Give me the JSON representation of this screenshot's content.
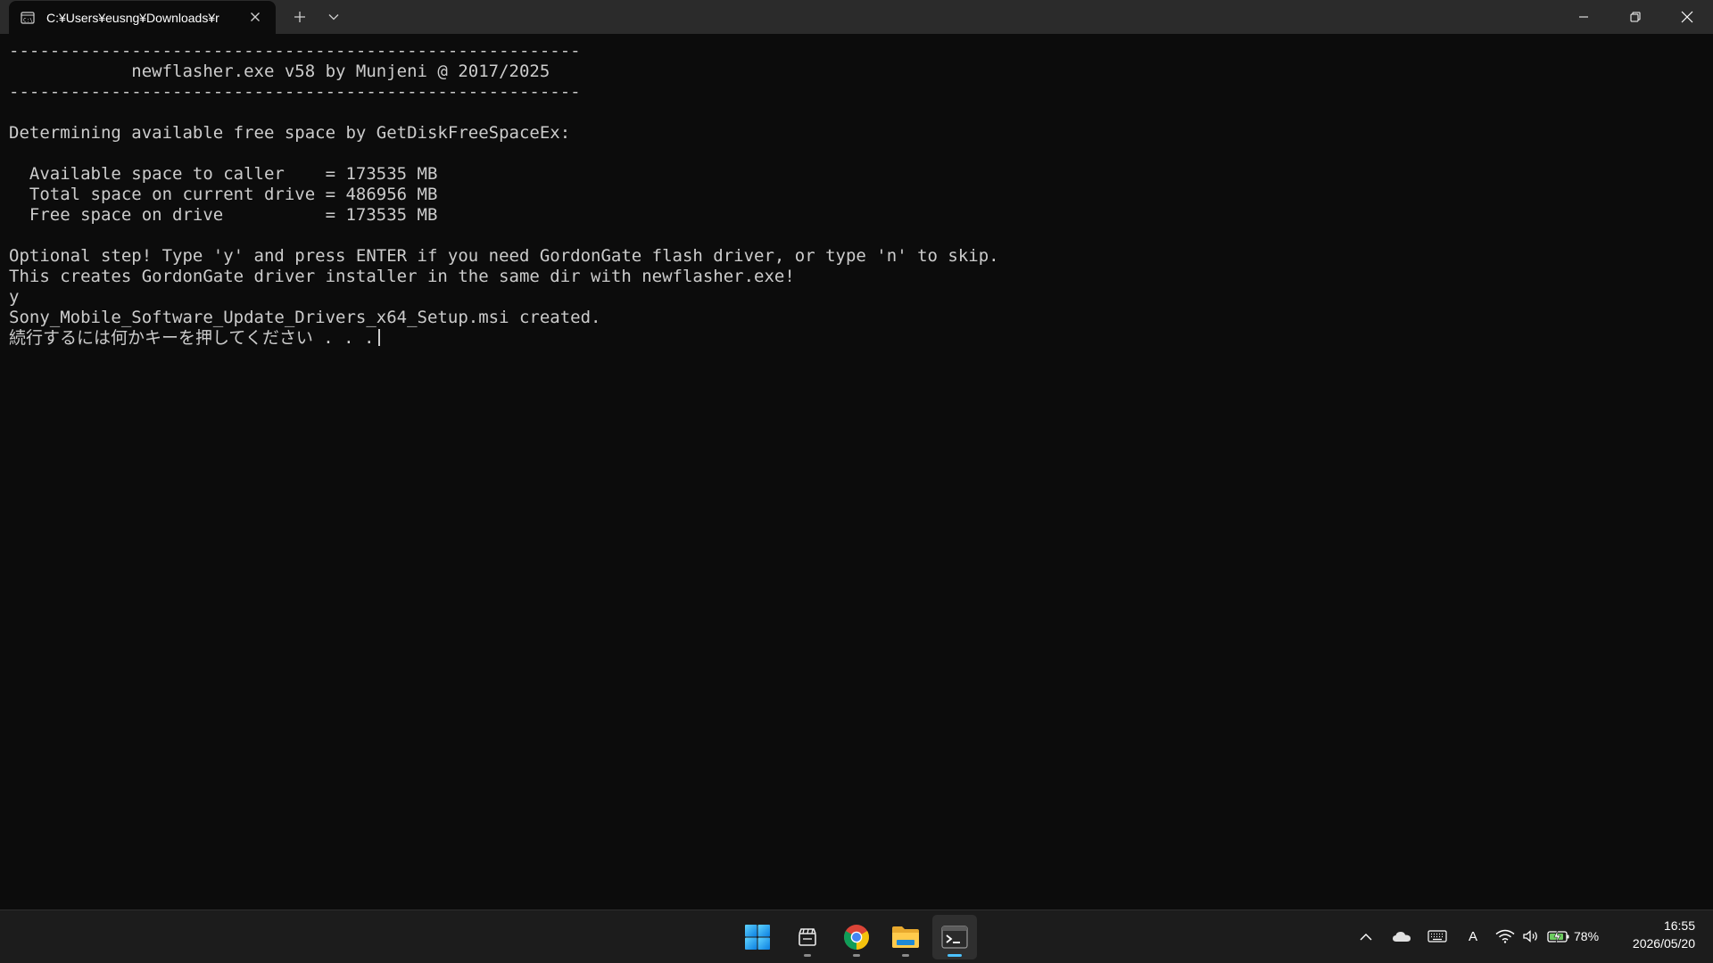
{
  "window": {
    "tab_title": "C:¥Users¥eusng¥Downloads¥r"
  },
  "terminal": {
    "lines": [
      "--------------------------------------------------------",
      "            newflasher.exe v58 by Munjeni @ 2017/2025",
      "--------------------------------------------------------",
      "",
      "Determining available free space by GetDiskFreeSpaceEx:",
      "",
      "  Available space to caller    = 173535 MB",
      "  Total space on current drive = 486956 MB",
      "  Free space on drive          = 173535 MB",
      "",
      "Optional step! Type 'y' and press ENTER if you need GordonGate flash driver, or type 'n' to skip.",
      "This creates GordonGate driver installer in the same dir with newflasher.exe!",
      "y",
      "Sony_Mobile_Software_Update_Drivers_x64_Setup.msi created.",
      "続行するには何かキーを押してください . . ."
    ]
  },
  "taskbar": {
    "apps": [
      {
        "name": "start-button",
        "icon": "windows-logo-icon"
      },
      {
        "name": "files-app",
        "icon": "clapper-files-icon"
      },
      {
        "name": "chrome-app",
        "icon": "chrome-icon"
      },
      {
        "name": "file-explorer-app",
        "icon": "folder-icon"
      },
      {
        "name": "terminal-app",
        "icon": "terminal-icon"
      }
    ],
    "tray": {
      "ime_mode": "A",
      "battery_percent": "78%",
      "time": "16:55",
      "date": "2026/05/20"
    }
  },
  "colors": {
    "terminal_bg": "#0c0c0c",
    "terminal_fg": "#cccccc",
    "titlebar_bg": "#2b2b2b",
    "taskbar_bg": "#1c1c1c",
    "accent": "#4cc2ff"
  }
}
